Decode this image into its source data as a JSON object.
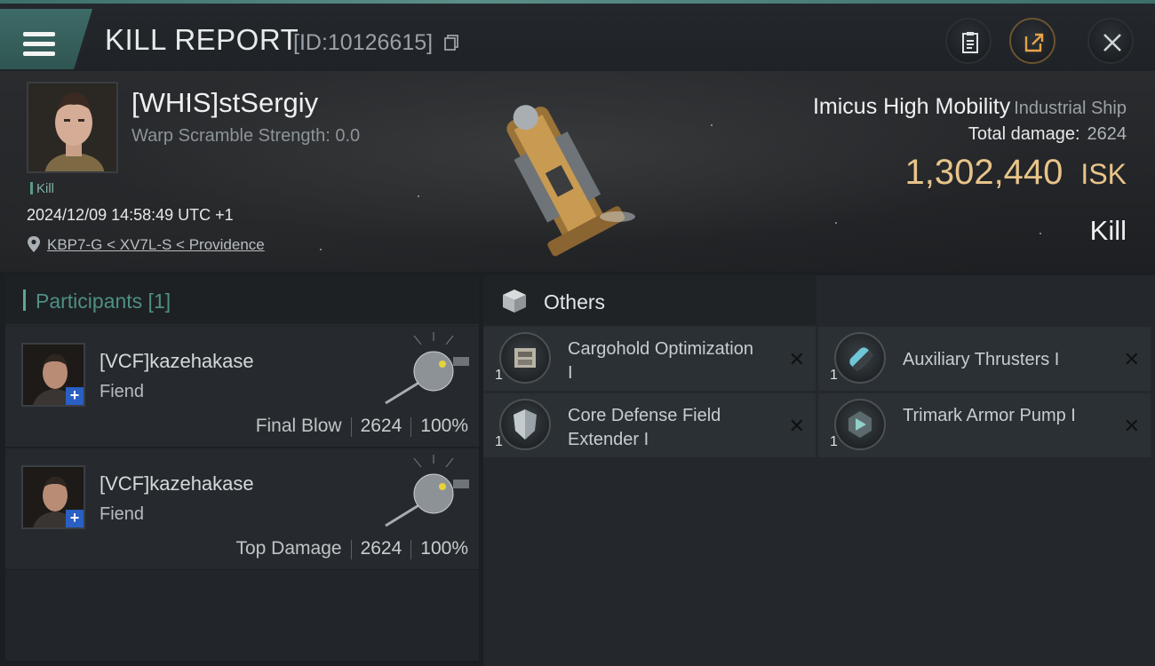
{
  "header": {
    "title": "KILL REPORT",
    "id_text": "[ID:10126615]"
  },
  "victim": {
    "name": "[WHIS]stSergiy",
    "warp_scramble": "Warp Scramble Strength: 0.0",
    "tag": "Kill",
    "datetime": "2024/12/09 14:58:49 UTC +1",
    "location": "KBP7-G < XV7L-S < Providence",
    "ship_name": "Imicus High Mobility",
    "ship_class": "Industrial Ship",
    "total_damage_label": "Total damage:",
    "total_damage_value": "2624",
    "isk_amount": "1,302,440",
    "isk_unit": "ISK",
    "result": "Kill"
  },
  "participants": {
    "title": "Participants [1]",
    "rows": [
      {
        "name": "[VCF]kazehakase",
        "ship": "Fiend",
        "label": "Final Blow",
        "damage": "2624",
        "percent": "100%"
      },
      {
        "name": "[VCF]kazehakase",
        "ship": "Fiend",
        "label": "Top Damage",
        "damage": "2624",
        "percent": "100%"
      }
    ]
  },
  "others": {
    "title": "Others",
    "items": [
      {
        "qty": "1",
        "name": "Cargohold Optimization I",
        "icon": "cargohold-module-icon"
      },
      {
        "qty": "1",
        "name": "Auxiliary Thrusters I",
        "icon": "thruster-module-icon"
      },
      {
        "qty": "1",
        "name": "Core Defense Field Extender I",
        "icon": "shield-extender-icon"
      },
      {
        "qty": "1",
        "name": "Trimark Armor Pump I",
        "icon": "armor-pump-icon"
      }
    ]
  },
  "colors": {
    "accent_teal": "#5fa596",
    "isk_gold": "#e8c48a",
    "plus_badge": "#2a5fc4"
  }
}
